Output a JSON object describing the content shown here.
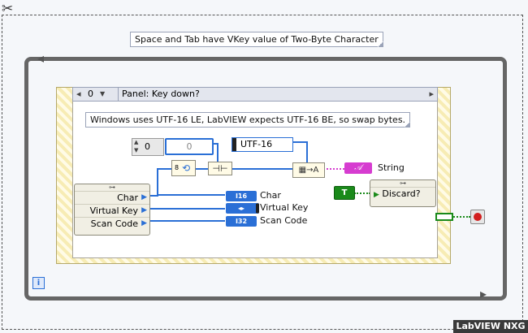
{
  "diagram": {
    "top_comment": "Space and Tab have VKey value of Two-Byte Character",
    "case_selector_value": "0",
    "case_label": "Panel: Key down?",
    "inner_comment": "Windows uses UTF-16 LE, LabVIEW expects UTF-16 BE, so swap bytes.",
    "numeric_const": "0",
    "array_index": "0",
    "encoding_const": "UTF-16",
    "swap_width": "8",
    "string_label": "String",
    "cluster_items": [
      "Char",
      "Virtual Key",
      "Scan Code"
    ],
    "indicator_labels": [
      "Char",
      "Virtual Key",
      "Scan Code"
    ],
    "indicator_types": [
      "I16",
      "◂▸",
      "I32"
    ],
    "discard_label": "Discard?",
    "bool_const": "T",
    "info_icon": "i",
    "brand_badge": "LabVIEW NXG"
  }
}
